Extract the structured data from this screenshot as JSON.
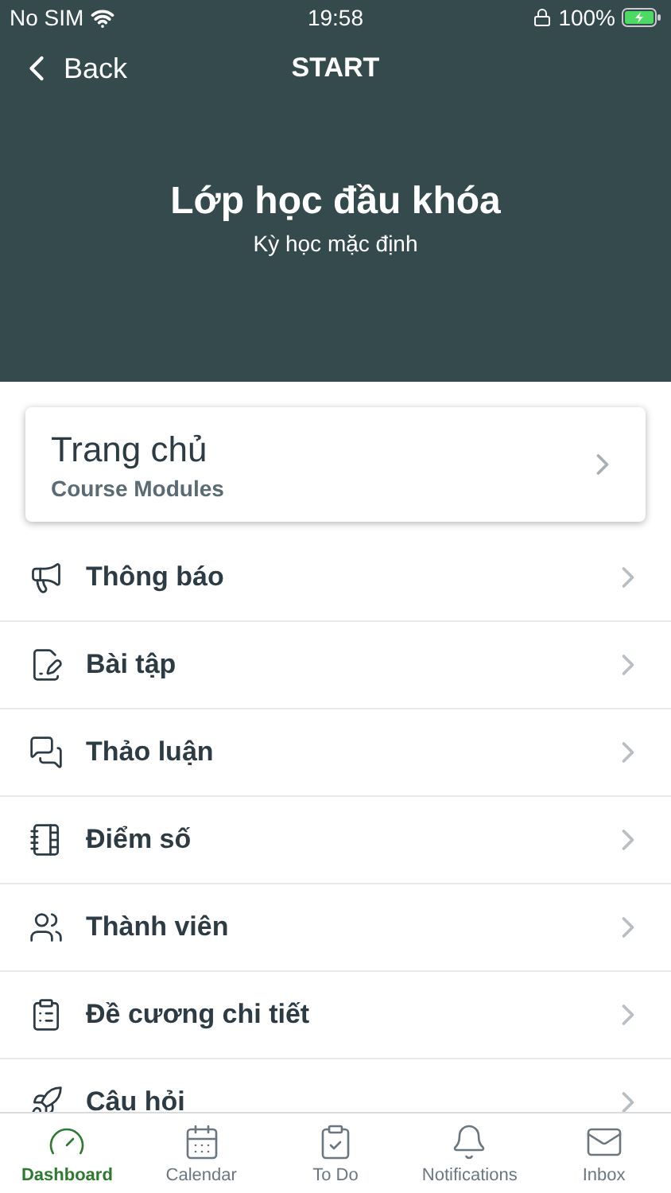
{
  "status_bar": {
    "carrier": "No SIM",
    "time": "19:58",
    "battery": "100%"
  },
  "nav": {
    "back": "Back",
    "title": "START"
  },
  "header": {
    "title": "Lớp học đầu khóa",
    "subtitle": "Kỳ học mặc định"
  },
  "home_card": {
    "title": "Trang chủ",
    "subtitle": "Course Modules"
  },
  "menu": [
    {
      "label": "Thông báo"
    },
    {
      "label": "Bài tập"
    },
    {
      "label": "Thảo luận"
    },
    {
      "label": "Điểm số"
    },
    {
      "label": "Thành viên"
    },
    {
      "label": "Đề cương chi tiết"
    },
    {
      "label": "Câu hỏi"
    }
  ],
  "tab_bar": [
    {
      "label": "Dashboard",
      "selected": true
    },
    {
      "label": "Calendar",
      "selected": false
    },
    {
      "label": "To Do",
      "selected": false
    },
    {
      "label": "Notifications",
      "selected": false
    },
    {
      "label": "Inbox",
      "selected": false
    }
  ]
}
